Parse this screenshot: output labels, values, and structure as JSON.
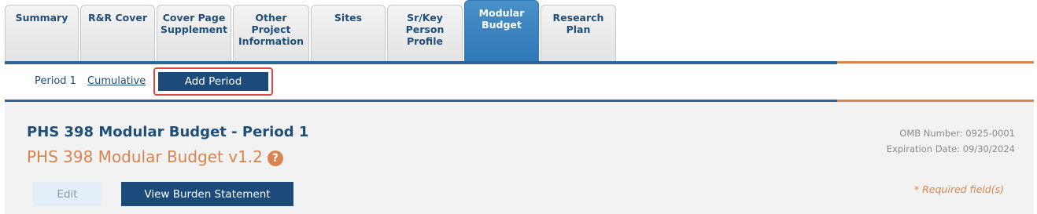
{
  "tabs": [
    {
      "label": "Summary",
      "active": false
    },
    {
      "label": "R&R Cover",
      "active": false
    },
    {
      "label": "Cover Page\nSupplement",
      "active": false
    },
    {
      "label": "Other\nProject\nInformation",
      "active": false
    },
    {
      "label": "Sites",
      "active": false
    },
    {
      "label": "Sr/Key\nPerson\nProfile",
      "active": false
    },
    {
      "label": "Modular\nBudget",
      "active": true
    },
    {
      "label": "Research\nPlan",
      "active": false
    }
  ],
  "subnav": {
    "period1": "Period 1",
    "cumulative": "Cumulative",
    "add_period": "Add Period"
  },
  "header": {
    "title": "PHS 398 Modular Budget - Period 1",
    "form_name": "PHS 398 Modular Budget v1.2",
    "help_icon": "?",
    "omb_number": "OMB Number: 0925-0001",
    "expiration": "Expiration Date: 09/30/2024"
  },
  "actions": {
    "edit": "Edit",
    "view_burden": "View Burden Statement",
    "required_note": "* Required field(s)"
  },
  "colors": {
    "primary": "#1c4a7a",
    "accent": "#d9844f",
    "tab_active": "#2e78b7",
    "highlight": "#e04545"
  }
}
